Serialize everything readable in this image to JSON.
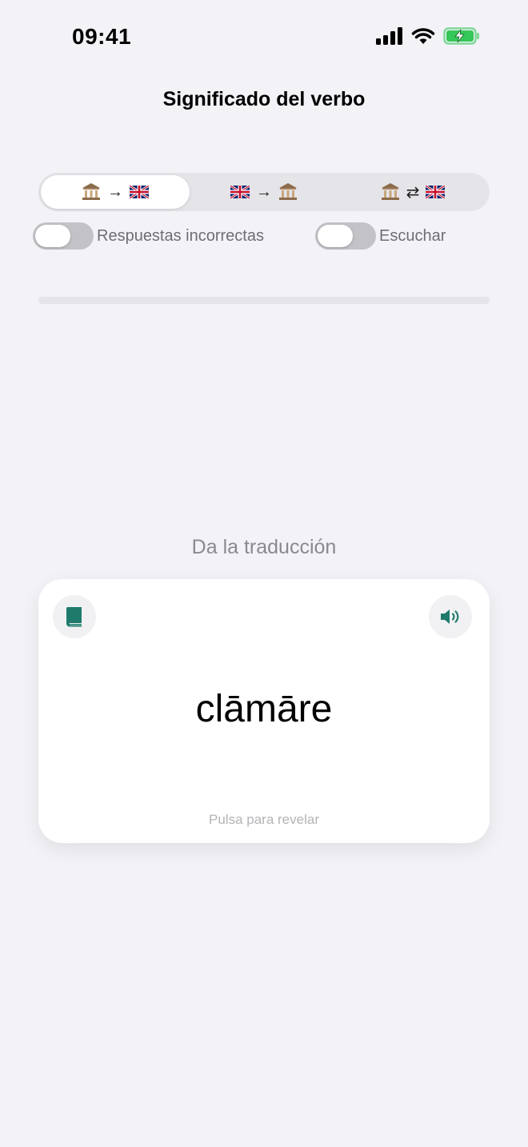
{
  "status_bar": {
    "time": "09:41"
  },
  "header": {
    "title": "Significado del verbo"
  },
  "mode_selector": {
    "segments": [
      {
        "from_icon": "classical-building-icon",
        "arrow": "→",
        "to_icon": "uk-flag-icon",
        "selected": true
      },
      {
        "from_icon": "uk-flag-icon",
        "arrow": "→",
        "to_icon": "classical-building-icon",
        "selected": false
      },
      {
        "from_icon": "classical-building-icon",
        "arrow": "⇄",
        "to_icon": "uk-flag-icon",
        "selected": false
      }
    ]
  },
  "toggles": {
    "wrong_answers": {
      "label": "Respuestas incorrectas",
      "on": false
    },
    "listen": {
      "label": "Escuchar",
      "on": false
    }
  },
  "progress": {
    "value": 0
  },
  "prompt": "Da la traducción",
  "card": {
    "word": "clāmāre",
    "hint": "Pulsa para revelar",
    "left_icon": "book-icon",
    "right_icon": "speaker-icon"
  },
  "colors": {
    "accent": "#1f7a6c",
    "background": "#f2f2f7"
  }
}
